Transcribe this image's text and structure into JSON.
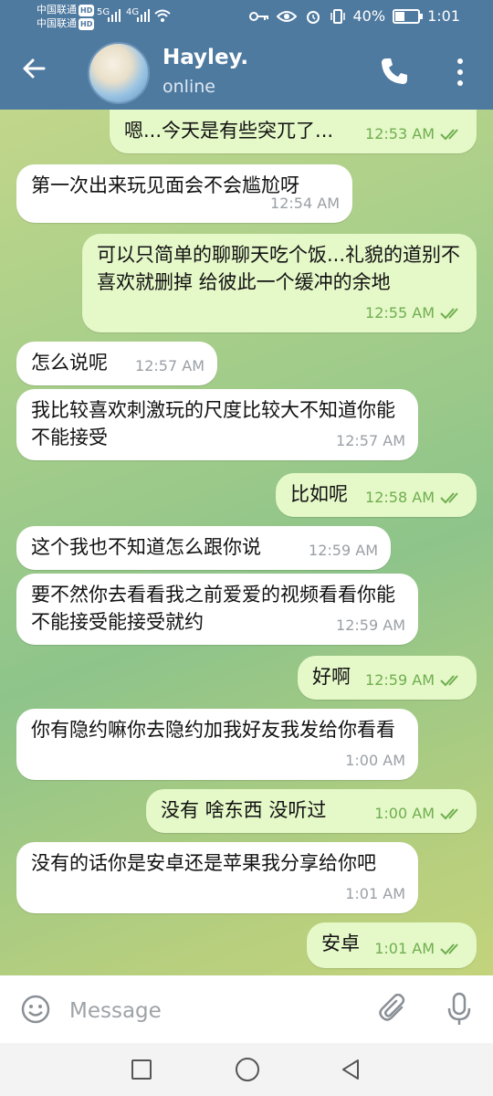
{
  "statusbar": {
    "carrier1": "中国联通",
    "carrier2": "中国联通",
    "hd": "HD",
    "network1": "5G",
    "network2": "4G",
    "battery": "40%",
    "time": "1:01"
  },
  "header": {
    "back_icon": "arrow-left-icon",
    "name": "Hayley.",
    "status": "online",
    "icons": [
      "phone-icon",
      "more-vertical-icon"
    ]
  },
  "messages": [
    {
      "dir": "out",
      "text": "嗯...今天是有些突兀了...",
      "time": "12:53 AM"
    },
    {
      "dir": "in",
      "text": "第一次出来玩见面会不会尴尬呀",
      "time": "12:54 AM"
    },
    {
      "dir": "out",
      "text": "可以只简单的聊聊天吃个饭...礼貌的道别不喜欢就删掉  给彼此一个缓冲的余地",
      "time": "12:55 AM"
    },
    {
      "dir": "in",
      "text": "怎么说呢",
      "time": "12:57 AM"
    },
    {
      "dir": "in",
      "text": "我比较喜欢刺激玩的尺度比较大不知道你能不能接受",
      "time": "12:57 AM"
    },
    {
      "dir": "out",
      "text": "比如呢",
      "time": "12:58 AM"
    },
    {
      "dir": "in",
      "text": "这个我也不知道怎么跟你说",
      "time": "12:59 AM"
    },
    {
      "dir": "in",
      "text": "要不然你去看看我之前爱爱的视频看看你能不能接受能接受就约",
      "time": "12:59 AM"
    },
    {
      "dir": "out",
      "text": "好啊",
      "time": "12:59 AM"
    },
    {
      "dir": "in",
      "text": "你有隐约嘛你去隐约加我好友我发给你看看",
      "time": "1:00 AM"
    },
    {
      "dir": "out",
      "text": "没有   啥东西  没听过",
      "time": "1:00 AM"
    },
    {
      "dir": "in",
      "text": "没有的话你是安卓还是苹果我分享给你吧",
      "time": "1:01 AM"
    },
    {
      "dir": "out",
      "text": "安卓",
      "time": "1:01 AM"
    }
  ],
  "input": {
    "placeholder": "Message",
    "icons": [
      "emoji-icon",
      "attach-icon",
      "mic-icon"
    ]
  },
  "navbar": {
    "icons": [
      "recent-apps-icon",
      "home-icon",
      "back-icon"
    ]
  },
  "colors": {
    "header": "#4f7aa0",
    "incoming_bubble": "#ffffff",
    "outgoing_bubble": "#e5f8c8",
    "outgoing_meta": "#6fae4f"
  }
}
